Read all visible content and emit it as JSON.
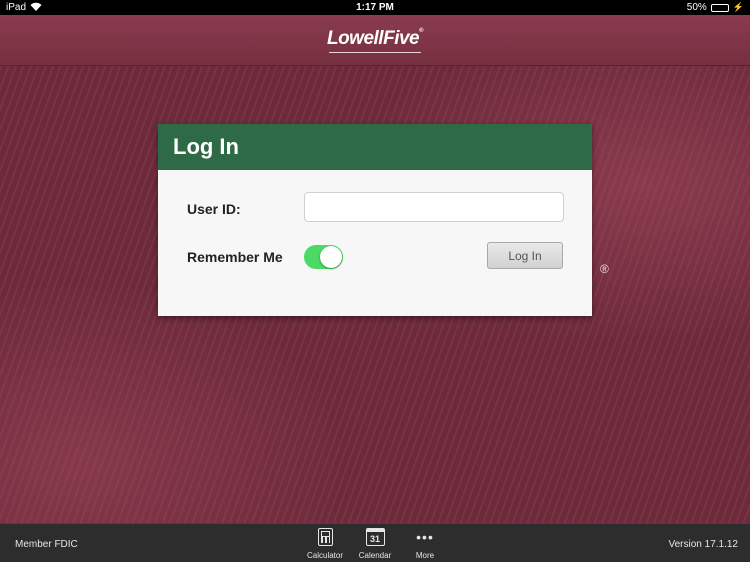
{
  "status_bar": {
    "device": "iPad",
    "time": "1:17 PM",
    "battery": "50%",
    "battery_level": 0.5
  },
  "header": {
    "logo_text": "LowellFive",
    "logo_mark": "®"
  },
  "login": {
    "title": "Log In",
    "user_id_label": "User ID:",
    "user_id_value": "",
    "user_id_placeholder": "",
    "remember_me_label": "Remember Me",
    "remember_me_on": true,
    "login_button": "Log In"
  },
  "toolbar": {
    "member_fdic": "Member FDIC",
    "version": "Version 17.1.12",
    "items": [
      {
        "label": "Calculator",
        "icon": "calculator-icon"
      },
      {
        "label": "Calendar",
        "icon": "calendar-icon",
        "icon_text": "31"
      },
      {
        "label": "More",
        "icon": "more-icon"
      }
    ]
  },
  "colors": {
    "background": "#6e2a3b",
    "header": "#8a3b4f",
    "card_header": "#2e6a45",
    "toggle_on": "#4cd964",
    "toolbar": "#2d2d2d"
  }
}
